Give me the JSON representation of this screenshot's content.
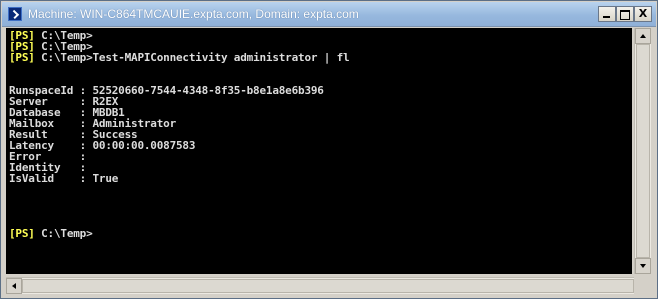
{
  "window": {
    "title": "Machine: WIN-C864TMCAUIE.expta.com, Domain: expta.com",
    "app_icon": "powershell-icon",
    "controls": {
      "minimize_label": "_",
      "maximize_label": "□",
      "close_label": "X"
    }
  },
  "console": {
    "background": "#000000",
    "prompt_color": "#ffff55",
    "text_color": "#dcdcdc",
    "lines": [
      {
        "prompt": "[PS]",
        "text": " C:\\Temp>"
      },
      {
        "prompt": "[PS]",
        "text": " C:\\Temp>"
      },
      {
        "prompt": "[PS]",
        "text": " C:\\Temp>Test-MAPIConnectivity administrator | fl"
      },
      {
        "prompt": "",
        "text": ""
      },
      {
        "prompt": "",
        "text": ""
      },
      {
        "prompt": "",
        "text": "RunspaceId : 52520660-7544-4348-8f35-b8e1a8e6b396"
      },
      {
        "prompt": "",
        "text": "Server     : R2EX"
      },
      {
        "prompt": "",
        "text": "Database   : MBDB1"
      },
      {
        "prompt": "",
        "text": "Mailbox    : Administrator"
      },
      {
        "prompt": "",
        "text": "Result     : Success"
      },
      {
        "prompt": "",
        "text": "Latency    : 00:00:00.0087583"
      },
      {
        "prompt": "",
        "text": "Error      :"
      },
      {
        "prompt": "",
        "text": "Identity   :"
      },
      {
        "prompt": "",
        "text": "IsValid    : True"
      },
      {
        "prompt": "",
        "text": ""
      },
      {
        "prompt": "",
        "text": ""
      },
      {
        "prompt": "",
        "text": ""
      },
      {
        "prompt": "",
        "text": ""
      },
      {
        "prompt": "[PS]",
        "text": " C:\\Temp>"
      }
    ]
  },
  "scrollbars": {
    "vertical": "scrollbar-vertical",
    "horizontal": "scrollbar-horizontal"
  }
}
